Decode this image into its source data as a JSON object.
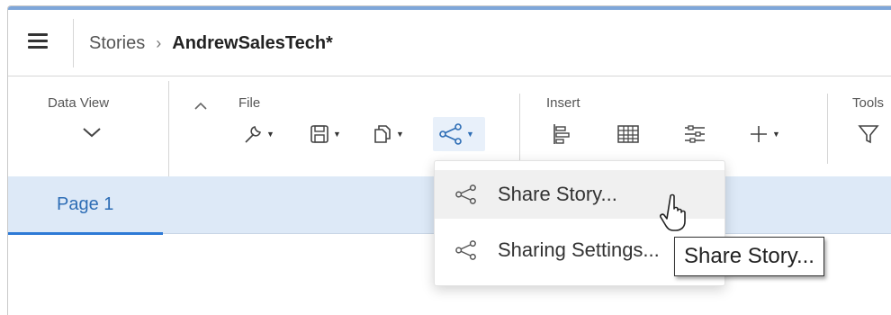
{
  "header": {
    "menu_icon": "hamburger-menu-icon",
    "breadcrumb_parent": "Stories",
    "breadcrumb_separator": "›",
    "breadcrumb_current": "AndrewSalesTech*"
  },
  "toolbar": {
    "data_view_label": "Data View",
    "file_label": "File",
    "insert_label": "Insert",
    "tools_label": "Tools",
    "file_buttons": [
      "wrench-icon",
      "save-icon",
      "copy-icon",
      "share-icon"
    ],
    "insert_buttons": [
      "align-icon",
      "table-icon",
      "input-control-icon",
      "add-icon"
    ],
    "tools_buttons": [
      "filter-icon"
    ]
  },
  "tabs": [
    {
      "label": "Page 1",
      "active": true
    }
  ],
  "share_menu": {
    "items": [
      {
        "label": "Share Story...",
        "icon": "share-icon",
        "hovered": true
      },
      {
        "label": "Sharing Settings...",
        "icon": "share-icon",
        "hovered": false
      }
    ]
  },
  "tooltip": {
    "text": "Share Story..."
  },
  "colors": {
    "accent": "#2d7ad6",
    "tab_strip": "#dde9f7",
    "tab_text": "#2d6db5"
  }
}
